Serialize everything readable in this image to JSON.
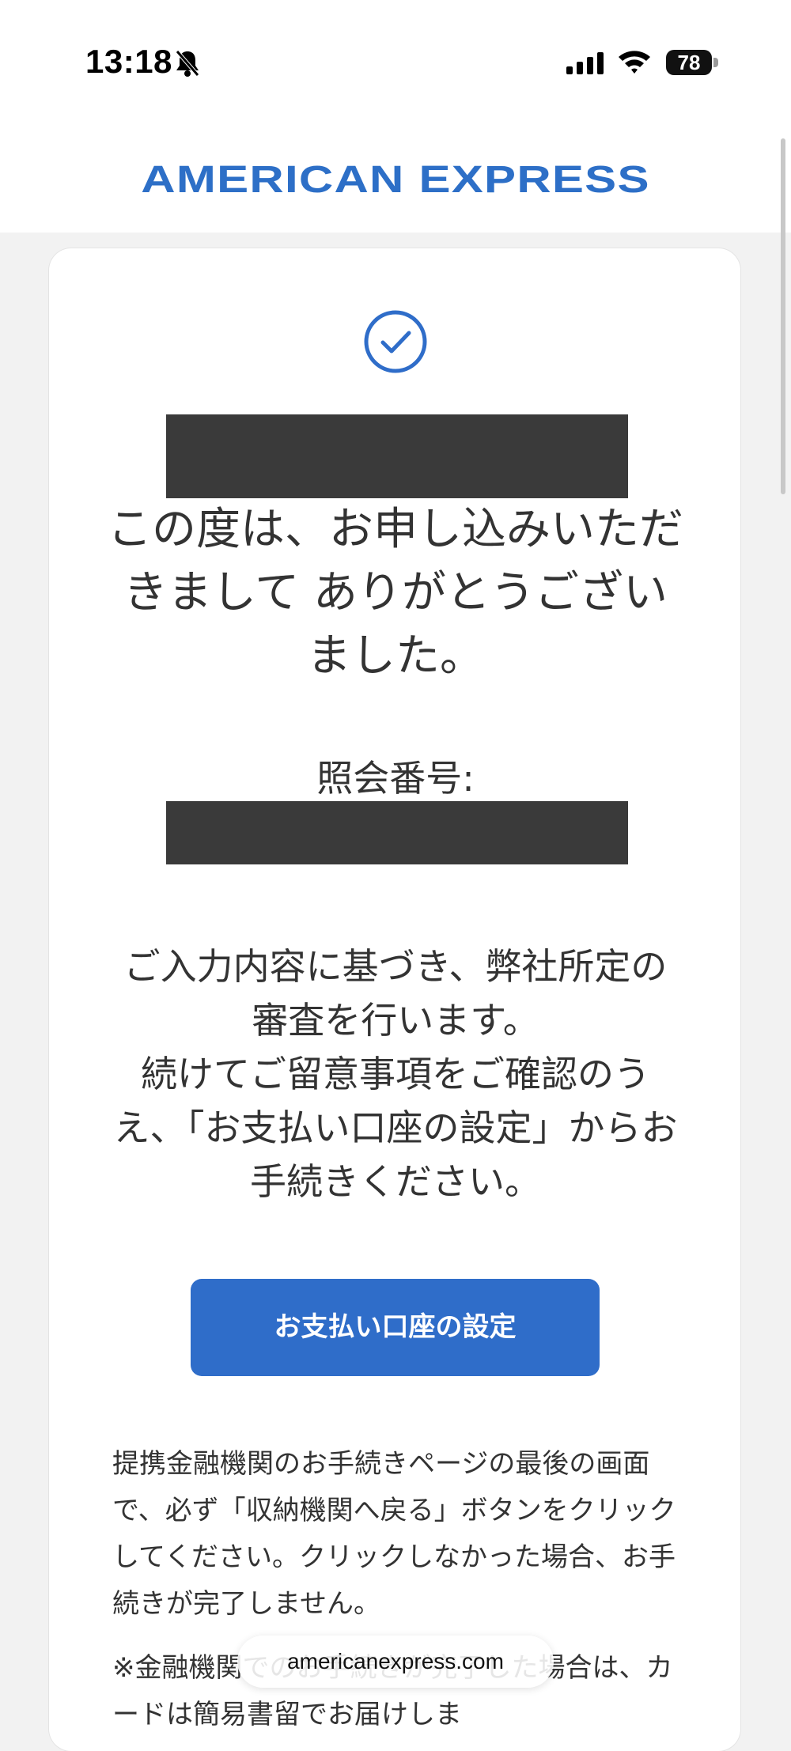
{
  "status_bar": {
    "time": "13:18",
    "battery": "78",
    "icons": [
      "bell-slash-icon",
      "signal-icon",
      "wifi-icon",
      "battery-icon"
    ]
  },
  "header": {
    "brand": "AMERICAN EXPRESS",
    "brand_color": "#2d6fc7"
  },
  "confirmation": {
    "icon": "check-circle-icon",
    "thanks": "この度は、お申し込みいただきまして ありがとうございました。",
    "reference_label": "照会番号:",
    "info": "ご入力内容に基づき、弊社所定の審査を行います。\n続けてご留意事項をご確認のうえ、「お支払い口座の設定」からお手続きください。",
    "pay_button": "お支払い口座の設定",
    "note": "提携金融機関のお手続きページの最後の画面で、必ず「収納機関へ戻る」ボタンをクリックしてください。クリックしなかった場合、お手続きが完了しません。",
    "note2": "※金融機関でのお手続きが完了した場合は、カードは簡易書留でお届けしま"
  },
  "browser": {
    "url": "americanexpress.com"
  },
  "colors": {
    "accent": "#2f6dc9",
    "background": "#f2f2f2",
    "redaction": "#3a3a3a"
  }
}
